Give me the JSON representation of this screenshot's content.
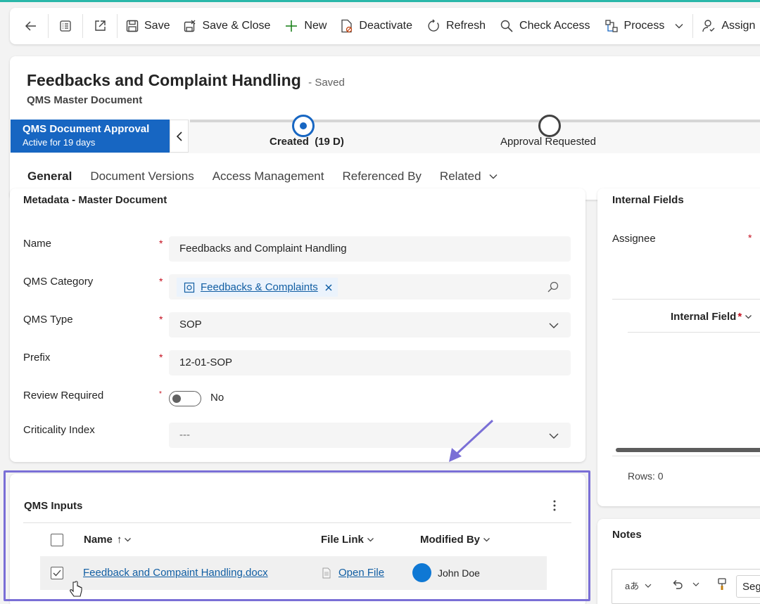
{
  "toolbar": {
    "back": "back",
    "save": "Save",
    "save_close": "Save & Close",
    "new": "New",
    "deactivate": "Deactivate",
    "refresh": "Refresh",
    "check_access": "Check Access",
    "process": "Process",
    "assign": "Assign"
  },
  "record": {
    "title": "Feedbacks and Complaint Handling",
    "status": "- Saved",
    "entity": "QMS Master Document"
  },
  "bpf": {
    "process_name": "QMS Document Approval",
    "active_for": "Active for 19 days",
    "stages": [
      {
        "label": "Created",
        "duration": "(19 D)"
      },
      {
        "label": "Approval Requested"
      }
    ]
  },
  "tabs": [
    "General",
    "Document Versions",
    "Access Management",
    "Referenced By",
    "Related"
  ],
  "form": {
    "section_title": "Metadata - Master Document",
    "fields": {
      "name": {
        "label": "Name",
        "value": "Feedbacks and Complaint Handling"
      },
      "category": {
        "label": "QMS Category",
        "value": "Feedbacks & Complaints"
      },
      "type": {
        "label": "QMS Type",
        "value": "SOP"
      },
      "prefix": {
        "label": "Prefix",
        "value": "12-01-SOP"
      },
      "review": {
        "label": "Review Required",
        "value": "No"
      },
      "criticality": {
        "label": "Criticality Index",
        "value": "---"
      }
    }
  },
  "right_panel": {
    "section_title": "Internal Fields",
    "assignee_label": "Assignee",
    "grid_column": "Internal Field",
    "rows_label": "Rows: 0"
  },
  "notes": {
    "title": "Notes",
    "font_value": "Seg"
  },
  "subgrid": {
    "title": "QMS Inputs",
    "columns": [
      "Name",
      "File Link",
      "Modified By"
    ],
    "rows": [
      {
        "name": "Feedback and Compaint Handling.docx",
        "file_link": "Open File",
        "modified_by": "John Doe"
      }
    ]
  },
  "colors": {
    "accent": "#1766c2",
    "highlight": "#7a6fd6",
    "required": "#c50f1f",
    "link": "#115ea3"
  }
}
